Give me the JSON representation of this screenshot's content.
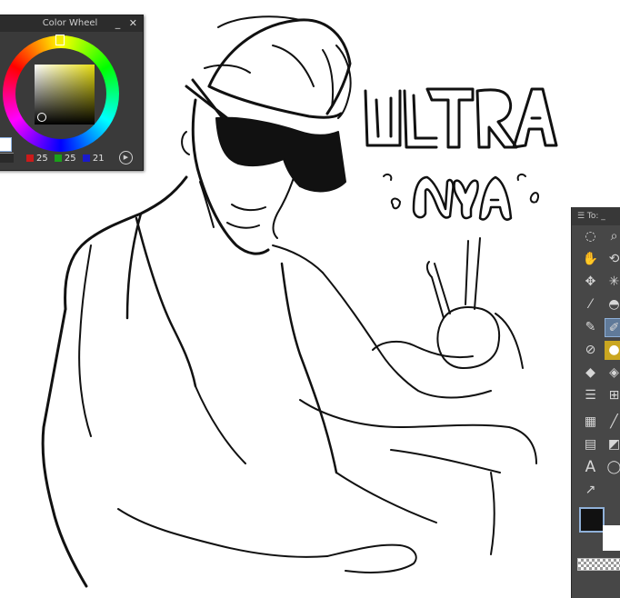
{
  "color_wheel": {
    "title": "Color Wheel",
    "minimize": "_",
    "close": "✕",
    "r_value": "25",
    "g_value": "25",
    "b_value": "21",
    "r_color": "#cc1a1a",
    "g_color": "#1aa01a",
    "b_color": "#1a1acc"
  },
  "canvas_text": {
    "ultra": "ULTRA",
    "nya": "NYA"
  },
  "tools_panel": {
    "title": "☰ To: _",
    "current_color": "#111111",
    "background_color": "#ffffff",
    "icons": [
      "lasso-icon",
      "zoom-icon",
      "hand-icon",
      "rotate-3d-icon",
      "move-icon",
      "sparkle-icon",
      "eyedropper-icon",
      "fill-bucket-icon",
      "pen-sub-icon",
      "pen-icon",
      "eraser-icon",
      "blend-icon",
      "eraser-2-icon",
      "fill-icon",
      "lines-icon",
      "grid-icon",
      "gradient-icon",
      "line-icon",
      "frame-icon",
      "ruler-icon",
      "text-icon",
      "balloon-icon",
      "correct-line-icon"
    ]
  }
}
